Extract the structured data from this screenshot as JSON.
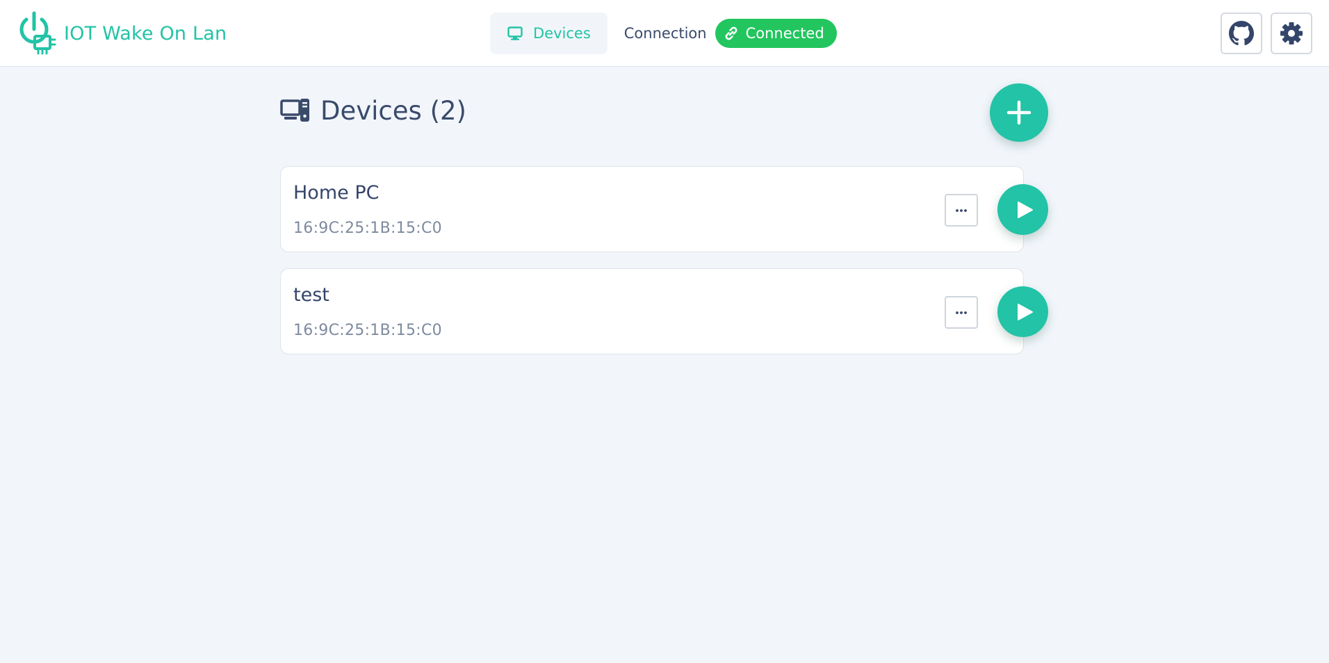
{
  "app": {
    "title": "IOT Wake On Lan",
    "accent_color": "#22c3a6",
    "logo_icon": "power-chip-icon"
  },
  "nav": {
    "tabs": [
      {
        "label": "Devices",
        "icon": "monitor-icon",
        "active": true
      },
      {
        "label": "Connection",
        "icon": "",
        "active": false
      }
    ],
    "connection_status": {
      "label": "Connected",
      "icon": "link-icon",
      "color": "#22c55e"
    }
  },
  "header_actions": {
    "github_icon": "github-icon",
    "settings_icon": "gear-icon"
  },
  "main": {
    "heading": "Devices (2)",
    "heading_icon": "devices-icon",
    "add_icon": "plus-icon",
    "devices": [
      {
        "name": "Home PC",
        "mac": "16:9C:25:1B:15:C0"
      },
      {
        "name": "test",
        "mac": "16:9C:25:1B:15:C0"
      }
    ],
    "more_icon": "ellipsis-icon",
    "wake_icon": "play-icon"
  }
}
